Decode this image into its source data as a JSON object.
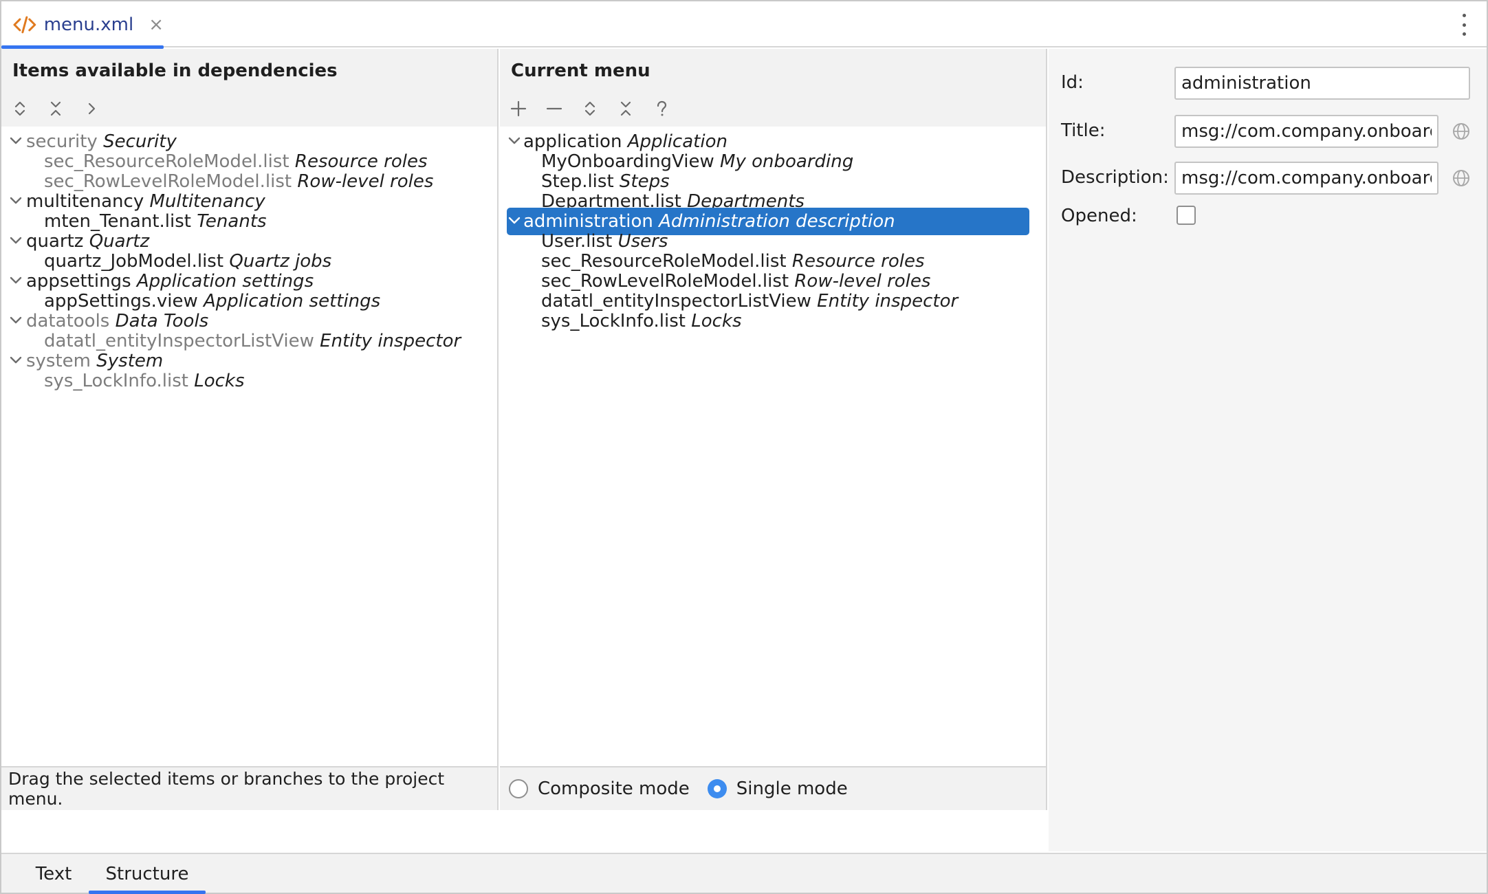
{
  "editor_tab": {
    "file_name": "menu.xml",
    "close_symbol": "×"
  },
  "left_panel": {
    "title": "Items available in dependencies",
    "toolbar": [
      "expand-all-icon",
      "collapse-all-icon",
      "chevron-right-icon"
    ],
    "tree": [
      {
        "id": "security",
        "caption": "Security",
        "grey": true,
        "children": [
          {
            "id": "sec_ResourceRoleModel.list",
            "caption": "Resource roles",
            "grey": true
          },
          {
            "id": "sec_RowLevelRoleModel.list",
            "caption": "Row-level roles",
            "grey": true
          }
        ]
      },
      {
        "id": "multitenancy",
        "caption": "Multitenancy",
        "grey": false,
        "children": [
          {
            "id": "mten_Tenant.list",
            "caption": "Tenants",
            "grey": false
          }
        ]
      },
      {
        "id": "quartz",
        "caption": "Quartz",
        "grey": false,
        "children": [
          {
            "id": "quartz_JobModel.list",
            "caption": "Quartz jobs",
            "grey": false
          }
        ]
      },
      {
        "id": "appsettings",
        "caption": "Application settings",
        "grey": false,
        "children": [
          {
            "id": "appSettings.view",
            "caption": "Application settings",
            "grey": false
          }
        ]
      },
      {
        "id": "datatools",
        "caption": "Data Tools",
        "grey": true,
        "children": [
          {
            "id": "datatl_entityInspectorListView",
            "caption": "Entity inspector",
            "grey": true
          }
        ]
      },
      {
        "id": "system",
        "caption": "System",
        "grey": true,
        "children": [
          {
            "id": "sys_LockInfo.list",
            "caption": "Locks",
            "grey": true
          }
        ]
      }
    ],
    "footer": "Drag the selected items or branches to the project menu."
  },
  "mid_panel": {
    "title": "Current menu",
    "toolbar": [
      "add-icon",
      "remove-icon",
      "expand-all-icon",
      "collapse-all-icon",
      "help-icon"
    ],
    "tree": [
      {
        "id": "application",
        "caption": "Application",
        "selected": false,
        "children": [
          {
            "id": "MyOnboardingView",
            "caption": "My onboarding"
          },
          {
            "id": "Step.list",
            "caption": "Steps"
          },
          {
            "id": "Department.list",
            "caption": "Departments"
          }
        ]
      },
      {
        "id": "administration",
        "caption": "Administration description",
        "selected": true,
        "children": [
          {
            "id": "User.list",
            "caption": "Users"
          },
          {
            "id": "sec_ResourceRoleModel.list",
            "caption": "Resource roles"
          },
          {
            "id": "sec_RowLevelRoleModel.list",
            "caption": "Row-level roles"
          },
          {
            "id": "datatl_entityInspectorListView",
            "caption": "Entity inspector"
          },
          {
            "id": "sys_LockInfo.list",
            "caption": "Locks"
          }
        ]
      }
    ],
    "modes": [
      {
        "label": "Composite mode",
        "checked": false
      },
      {
        "label": "Single mode",
        "checked": true
      }
    ]
  },
  "properties": {
    "id_label": "Id:",
    "id_value": "administration",
    "title_label": "Title:",
    "title_value": "msg://com.company.onboard",
    "description_label": "Description:",
    "description_value": "msg://com.company.onboard",
    "opened_label": "Opened:",
    "opened": false
  },
  "bottom_tabs": [
    {
      "label": "Text",
      "active": false
    },
    {
      "label": "Structure",
      "active": true
    }
  ],
  "colors": {
    "accent": "#3574f0",
    "selection": "#2675c8",
    "xml_icon": "#e07a1f"
  }
}
